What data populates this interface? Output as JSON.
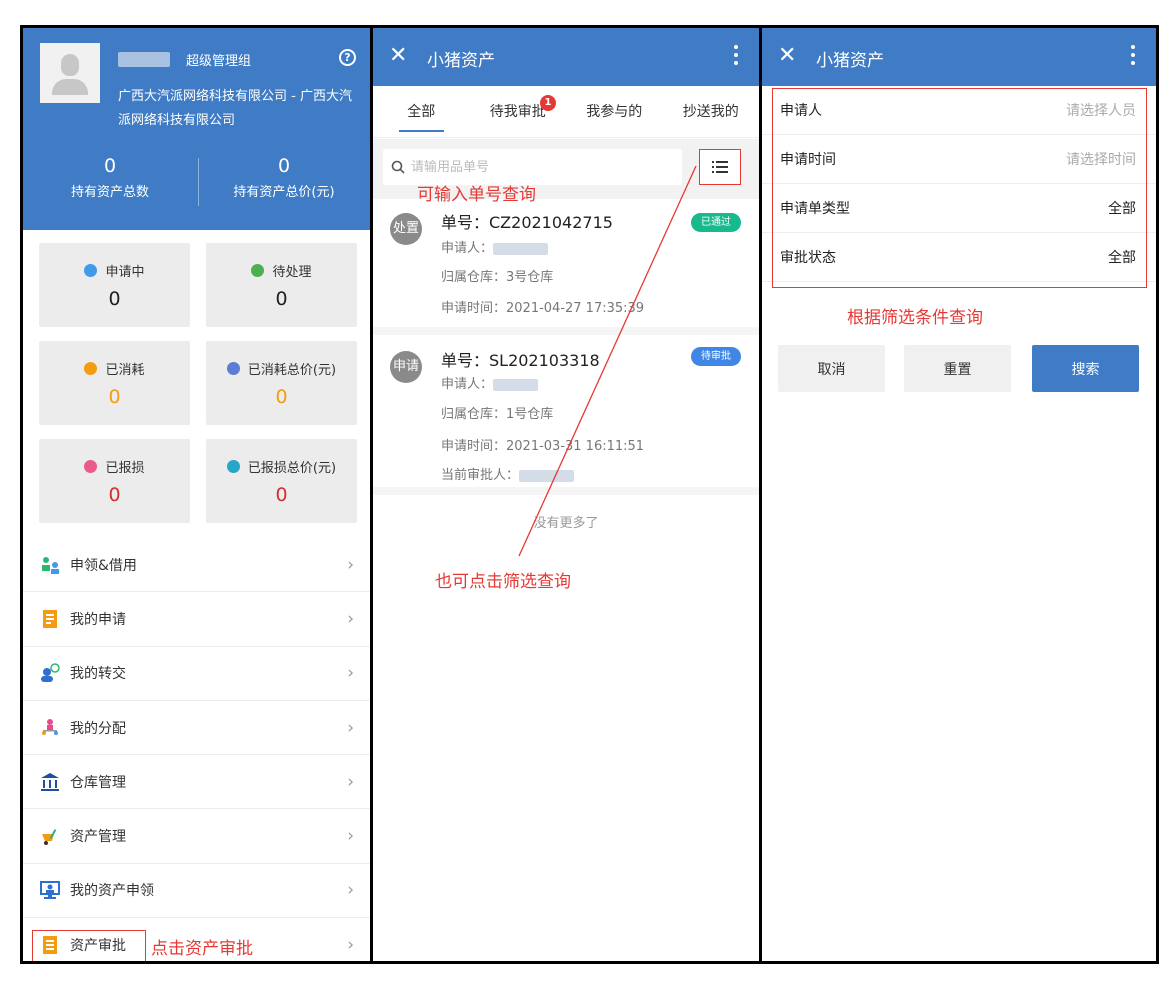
{
  "panel1": {
    "role": "超级管理组",
    "company": "广西大汽派网络科技有限公司 - 广西大汽派网络科技有限公司",
    "stats": [
      {
        "value": "0",
        "label": "持有资产总数"
      },
      {
        "value": "0",
        "label": "持有资产总价(元)"
      }
    ],
    "cards": [
      {
        "label": "申请中",
        "value": "0",
        "icon": "applying-icon"
      },
      {
        "label": "待处理",
        "value": "0",
        "icon": "pending-icon"
      },
      {
        "label": "已消耗",
        "value": "0",
        "icon": "consumed-icon"
      },
      {
        "label": "已消耗总价(元)",
        "value": "0",
        "icon": "consumed-value-icon"
      },
      {
        "label": "已报损",
        "value": "0",
        "icon": "damaged-icon"
      },
      {
        "label": "已报损总价(元)",
        "value": "0",
        "icon": "damaged-value-icon"
      }
    ],
    "menu": [
      {
        "label": "申领&借用",
        "icon": "apply-borrow-icon"
      },
      {
        "label": "我的申请",
        "icon": "my-application-icon"
      },
      {
        "label": "我的转交",
        "icon": "my-transfer-icon"
      },
      {
        "label": "我的分配",
        "icon": "my-allocation-icon"
      },
      {
        "label": "仓库管理",
        "icon": "warehouse-icon"
      },
      {
        "label": "资产管理",
        "icon": "asset-management-icon"
      },
      {
        "label": "我的资产申领",
        "icon": "my-asset-claim-icon"
      },
      {
        "label": "资产审批",
        "icon": "asset-approval-icon"
      }
    ],
    "note": "点击资产审批",
    "colors": {
      "header": "#3f7cc5",
      "annotation": "#e53935"
    }
  },
  "panel2": {
    "title": "小猪资产",
    "tabs": [
      "全部",
      "待我审批",
      "我参与的",
      "抄送我的"
    ],
    "badge": "1",
    "search_placeholder": "请输用品单号",
    "note_input": "可输入单号查询",
    "records": [
      {
        "icon_text": "处置",
        "number": "单号：CZ2021042715",
        "applicant": "申请人：",
        "warehouse": "归属仓库：3号仓库",
        "time": "申请时间：2021-04-27 17:35:39",
        "status": "已通过",
        "status_color": "#18b98c"
      },
      {
        "icon_text": "申请",
        "number": "单号：SL202103318",
        "applicant": "申请人：",
        "warehouse": "归属仓库：1号仓库",
        "time": "申请时间：2021-03-31 16:11:51",
        "approver": "当前审批人：",
        "status": "待审批",
        "status_color": "#3f86e5"
      }
    ],
    "no_more": "没有更多了",
    "note_filter": "也可点击筛选查询"
  },
  "panel3": {
    "title": "小猪资产",
    "fields": [
      {
        "label": "申请人",
        "value": "请选择人员"
      },
      {
        "label": "申请时间",
        "value": "请选择时间"
      },
      {
        "label": "申请单类型",
        "value": "全部"
      },
      {
        "label": "审批状态",
        "value": "全部"
      }
    ],
    "note": "根据筛选条件查询",
    "buttons": {
      "cancel": "取消",
      "reset": "重置",
      "search": "搜索"
    }
  }
}
